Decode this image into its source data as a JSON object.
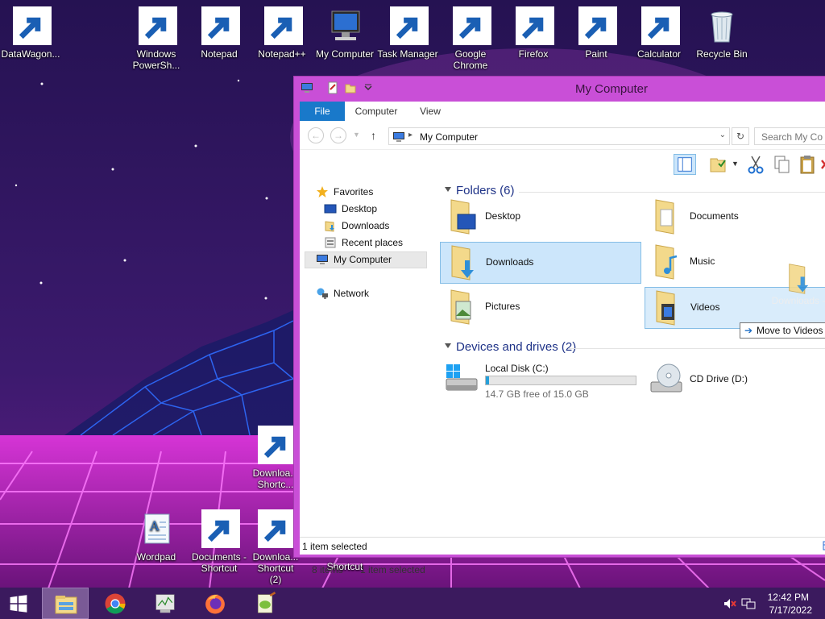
{
  "desktop": {
    "icons": [
      {
        "label": "DataWagon...",
        "icon": "datawagon-icon"
      },
      {
        "label": "Windows PowerSh...",
        "icon": "powershell-icon"
      },
      {
        "label": "Notepad",
        "icon": "notepad-icon"
      },
      {
        "label": "Notepad++",
        "icon": "notepad-plus-plus-icon"
      },
      {
        "label": "My Computer",
        "icon": "computer-icon"
      },
      {
        "label": "Task Manager",
        "icon": "task-manager-icon"
      },
      {
        "label": "Google Chrome",
        "icon": "chrome-icon"
      },
      {
        "label": "Firefox",
        "icon": "firefox-icon"
      },
      {
        "label": "Paint",
        "icon": "paint-icon"
      },
      {
        "label": "Calculator",
        "icon": "calculator-icon"
      },
      {
        "label": "Recycle Bin",
        "icon": "recycle-bin-icon"
      },
      {
        "label": "Downloa... Shortc...",
        "icon": "downloads-folder-icon"
      },
      {
        "label": "Wordpad",
        "icon": "wordpad-icon"
      },
      {
        "label": "Documents - Shortcut",
        "icon": "documents-folder-icon"
      },
      {
        "label": "Downloa... Shortcut (2)",
        "icon": "downloads-folder-icon"
      },
      {
        "label": "Shortcut",
        "icon": "shortcut-icon"
      }
    ]
  },
  "explorer": {
    "title": "My Computer",
    "tabs": [
      "File",
      "Computer",
      "View"
    ],
    "address": "My Computer",
    "search_placeholder": "Search My Co",
    "nav": {
      "favorites": "Favorites",
      "desktop": "Desktop",
      "downloads": "Downloads",
      "recent": "Recent places",
      "my_computer": "My Computer",
      "network": "Network"
    },
    "folders_header": "Folders (6)",
    "folders": [
      "Desktop",
      "Documents",
      "Downloads",
      "Music",
      "Pictures",
      "Videos"
    ],
    "devices_header": "Devices and drives (2)",
    "drives": [
      {
        "name": "Local Disk (C:)",
        "free": "14.7 GB free of 15.0 GB",
        "used_fraction": 0.02
      },
      {
        "name": "CD Drive (D:)"
      }
    ],
    "drag": {
      "ghost_label": "Downloads -",
      "tooltip": "Move to Videos"
    },
    "item_count": "8 items",
    "selected_count": "1 item selected",
    "status": "1 item selected"
  },
  "taskbar": {
    "time": "12:42 PM",
    "date": "7/17/2022"
  }
}
